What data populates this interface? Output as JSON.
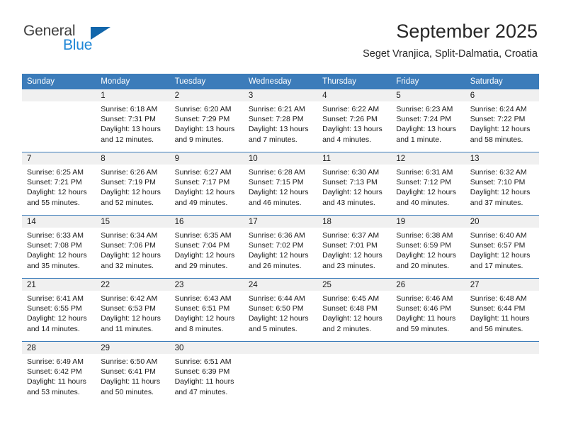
{
  "brand": {
    "name_part1": "General",
    "name_part2": "Blue",
    "logo_icon": "triangle-logo-icon",
    "color_primary": "#1266ab",
    "color_secondary": "#1e86d6"
  },
  "header": {
    "title": "September 2025",
    "subtitle": "Seget Vranjica, Split-Dalmatia, Croatia"
  },
  "calendar": {
    "header_bg": "#3c7cba",
    "daynum_bg": "#f0f0f0",
    "weekday_labels": [
      "Sunday",
      "Monday",
      "Tuesday",
      "Wednesday",
      "Thursday",
      "Friday",
      "Saturday"
    ],
    "weeks": [
      [
        {
          "day": "",
          "sunrise": "",
          "sunset": "",
          "daylight1": "",
          "daylight2": ""
        },
        {
          "day": "1",
          "sunrise": "Sunrise: 6:18 AM",
          "sunset": "Sunset: 7:31 PM",
          "daylight1": "Daylight: 13 hours",
          "daylight2": "and 12 minutes."
        },
        {
          "day": "2",
          "sunrise": "Sunrise: 6:20 AM",
          "sunset": "Sunset: 7:29 PM",
          "daylight1": "Daylight: 13 hours",
          "daylight2": "and 9 minutes."
        },
        {
          "day": "3",
          "sunrise": "Sunrise: 6:21 AM",
          "sunset": "Sunset: 7:28 PM",
          "daylight1": "Daylight: 13 hours",
          "daylight2": "and 7 minutes."
        },
        {
          "day": "4",
          "sunrise": "Sunrise: 6:22 AM",
          "sunset": "Sunset: 7:26 PM",
          "daylight1": "Daylight: 13 hours",
          "daylight2": "and 4 minutes."
        },
        {
          "day": "5",
          "sunrise": "Sunrise: 6:23 AM",
          "sunset": "Sunset: 7:24 PM",
          "daylight1": "Daylight: 13 hours",
          "daylight2": "and 1 minute."
        },
        {
          "day": "6",
          "sunrise": "Sunrise: 6:24 AM",
          "sunset": "Sunset: 7:22 PM",
          "daylight1": "Daylight: 12 hours",
          "daylight2": "and 58 minutes."
        }
      ],
      [
        {
          "day": "7",
          "sunrise": "Sunrise: 6:25 AM",
          "sunset": "Sunset: 7:21 PM",
          "daylight1": "Daylight: 12 hours",
          "daylight2": "and 55 minutes."
        },
        {
          "day": "8",
          "sunrise": "Sunrise: 6:26 AM",
          "sunset": "Sunset: 7:19 PM",
          "daylight1": "Daylight: 12 hours",
          "daylight2": "and 52 minutes."
        },
        {
          "day": "9",
          "sunrise": "Sunrise: 6:27 AM",
          "sunset": "Sunset: 7:17 PM",
          "daylight1": "Daylight: 12 hours",
          "daylight2": "and 49 minutes."
        },
        {
          "day": "10",
          "sunrise": "Sunrise: 6:28 AM",
          "sunset": "Sunset: 7:15 PM",
          "daylight1": "Daylight: 12 hours",
          "daylight2": "and 46 minutes."
        },
        {
          "day": "11",
          "sunrise": "Sunrise: 6:30 AM",
          "sunset": "Sunset: 7:13 PM",
          "daylight1": "Daylight: 12 hours",
          "daylight2": "and 43 minutes."
        },
        {
          "day": "12",
          "sunrise": "Sunrise: 6:31 AM",
          "sunset": "Sunset: 7:12 PM",
          "daylight1": "Daylight: 12 hours",
          "daylight2": "and 40 minutes."
        },
        {
          "day": "13",
          "sunrise": "Sunrise: 6:32 AM",
          "sunset": "Sunset: 7:10 PM",
          "daylight1": "Daylight: 12 hours",
          "daylight2": "and 37 minutes."
        }
      ],
      [
        {
          "day": "14",
          "sunrise": "Sunrise: 6:33 AM",
          "sunset": "Sunset: 7:08 PM",
          "daylight1": "Daylight: 12 hours",
          "daylight2": "and 35 minutes."
        },
        {
          "day": "15",
          "sunrise": "Sunrise: 6:34 AM",
          "sunset": "Sunset: 7:06 PM",
          "daylight1": "Daylight: 12 hours",
          "daylight2": "and 32 minutes."
        },
        {
          "day": "16",
          "sunrise": "Sunrise: 6:35 AM",
          "sunset": "Sunset: 7:04 PM",
          "daylight1": "Daylight: 12 hours",
          "daylight2": "and 29 minutes."
        },
        {
          "day": "17",
          "sunrise": "Sunrise: 6:36 AM",
          "sunset": "Sunset: 7:02 PM",
          "daylight1": "Daylight: 12 hours",
          "daylight2": "and 26 minutes."
        },
        {
          "day": "18",
          "sunrise": "Sunrise: 6:37 AM",
          "sunset": "Sunset: 7:01 PM",
          "daylight1": "Daylight: 12 hours",
          "daylight2": "and 23 minutes."
        },
        {
          "day": "19",
          "sunrise": "Sunrise: 6:38 AM",
          "sunset": "Sunset: 6:59 PM",
          "daylight1": "Daylight: 12 hours",
          "daylight2": "and 20 minutes."
        },
        {
          "day": "20",
          "sunrise": "Sunrise: 6:40 AM",
          "sunset": "Sunset: 6:57 PM",
          "daylight1": "Daylight: 12 hours",
          "daylight2": "and 17 minutes."
        }
      ],
      [
        {
          "day": "21",
          "sunrise": "Sunrise: 6:41 AM",
          "sunset": "Sunset: 6:55 PM",
          "daylight1": "Daylight: 12 hours",
          "daylight2": "and 14 minutes."
        },
        {
          "day": "22",
          "sunrise": "Sunrise: 6:42 AM",
          "sunset": "Sunset: 6:53 PM",
          "daylight1": "Daylight: 12 hours",
          "daylight2": "and 11 minutes."
        },
        {
          "day": "23",
          "sunrise": "Sunrise: 6:43 AM",
          "sunset": "Sunset: 6:51 PM",
          "daylight1": "Daylight: 12 hours",
          "daylight2": "and 8 minutes."
        },
        {
          "day": "24",
          "sunrise": "Sunrise: 6:44 AM",
          "sunset": "Sunset: 6:50 PM",
          "daylight1": "Daylight: 12 hours",
          "daylight2": "and 5 minutes."
        },
        {
          "day": "25",
          "sunrise": "Sunrise: 6:45 AM",
          "sunset": "Sunset: 6:48 PM",
          "daylight1": "Daylight: 12 hours",
          "daylight2": "and 2 minutes."
        },
        {
          "day": "26",
          "sunrise": "Sunrise: 6:46 AM",
          "sunset": "Sunset: 6:46 PM",
          "daylight1": "Daylight: 11 hours",
          "daylight2": "and 59 minutes."
        },
        {
          "day": "27",
          "sunrise": "Sunrise: 6:48 AM",
          "sunset": "Sunset: 6:44 PM",
          "daylight1": "Daylight: 11 hours",
          "daylight2": "and 56 minutes."
        }
      ],
      [
        {
          "day": "28",
          "sunrise": "Sunrise: 6:49 AM",
          "sunset": "Sunset: 6:42 PM",
          "daylight1": "Daylight: 11 hours",
          "daylight2": "and 53 minutes."
        },
        {
          "day": "29",
          "sunrise": "Sunrise: 6:50 AM",
          "sunset": "Sunset: 6:41 PM",
          "daylight1": "Daylight: 11 hours",
          "daylight2": "and 50 minutes."
        },
        {
          "day": "30",
          "sunrise": "Sunrise: 6:51 AM",
          "sunset": "Sunset: 6:39 PM",
          "daylight1": "Daylight: 11 hours",
          "daylight2": "and 47 minutes."
        },
        {
          "day": "",
          "sunrise": "",
          "sunset": "",
          "daylight1": "",
          "daylight2": ""
        },
        {
          "day": "",
          "sunrise": "",
          "sunset": "",
          "daylight1": "",
          "daylight2": ""
        },
        {
          "day": "",
          "sunrise": "",
          "sunset": "",
          "daylight1": "",
          "daylight2": ""
        },
        {
          "day": "",
          "sunrise": "",
          "sunset": "",
          "daylight1": "",
          "daylight2": ""
        }
      ]
    ]
  }
}
